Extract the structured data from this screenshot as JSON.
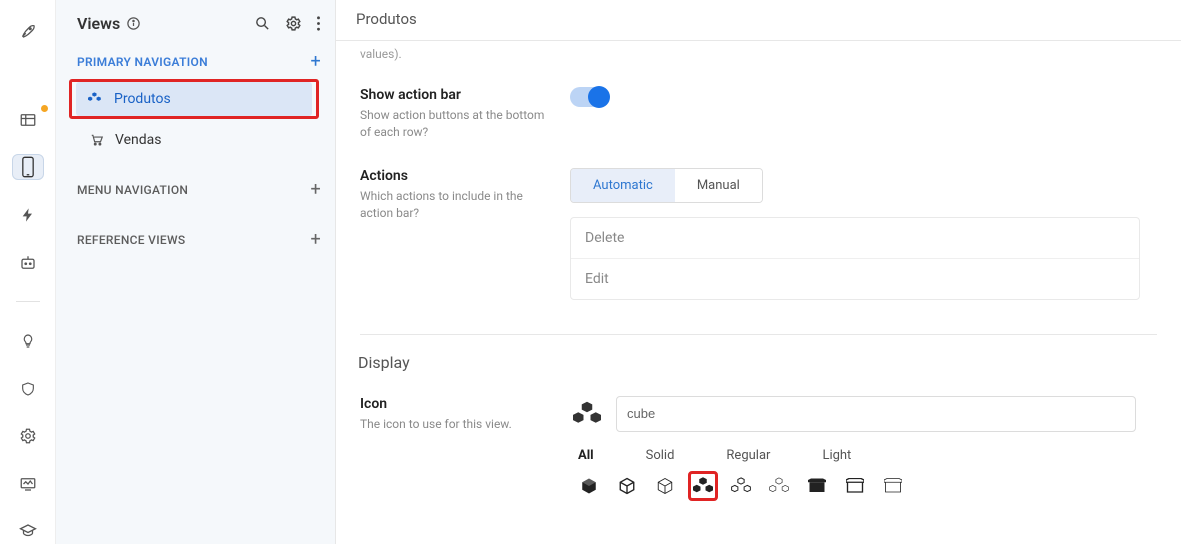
{
  "sidebar": {
    "title": "Views",
    "sections": [
      {
        "label": "PRIMARY NAVIGATION",
        "items": [
          {
            "label": "Produtos"
          },
          {
            "label": "Vendas"
          }
        ]
      },
      {
        "label": "MENU NAVIGATION"
      },
      {
        "label": "REFERENCE VIEWS"
      }
    ]
  },
  "page": {
    "title": "Produtos",
    "trail": "values).",
    "action_bar": {
      "title": "Show action bar",
      "desc": "Show action buttons at the bottom of each row?"
    },
    "actions": {
      "title": "Actions",
      "desc": "Which actions to include in the action bar?",
      "tabs": {
        "auto": "Automatic",
        "manual": "Manual"
      },
      "list": [
        "Delete",
        "Edit"
      ]
    },
    "display": {
      "section": "Display",
      "icon_label": "Icon",
      "icon_desc": "The icon to use for this view.",
      "icon_search": "cube",
      "tabs": {
        "all": "All",
        "solid": "Solid",
        "regular": "Regular",
        "light": "Light"
      }
    }
  }
}
